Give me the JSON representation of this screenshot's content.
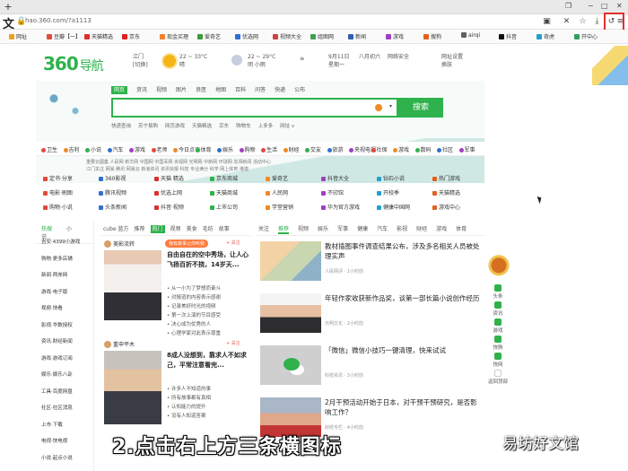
{
  "browser": {
    "url": "hao.360.com/?a1113",
    "window_buttons": [
      "−",
      "□",
      "✕"
    ],
    "addr_letter": "文"
  },
  "bookmarks": [
    {
      "label": "网址",
      "color": "#f0a020"
    },
    {
      "label": "豆瓣【一】",
      "color": "#e24a3b"
    },
    {
      "label": "天猫精选",
      "color": "#d83030"
    },
    {
      "label": "京东",
      "color": "#e02020"
    },
    {
      "label": "现金买理",
      "color": "#f08030"
    },
    {
      "label": "爱奇艺",
      "color": "#3a9a3a"
    },
    {
      "label": "优选网",
      "color": "#3070d0"
    },
    {
      "label": "视频大全",
      "color": "#d04040"
    },
    {
      "label": "组图网",
      "color": "#40a050"
    },
    {
      "label": "新闻",
      "color": "#3060b0"
    },
    {
      "label": "游戏",
      "color": "#a040c0"
    },
    {
      "label": "搜狗",
      "color": "#e06020"
    },
    {
      "label": "airqi",
      "color": "#606060"
    },
    {
      "label": "抖音",
      "color": "#111111"
    },
    {
      "label": "奇虎",
      "color": "#20a0d0"
    },
    {
      "label": "开中心",
      "color": "#30a060"
    }
  ],
  "header": {
    "logo_text": "360",
    "logo_sub": "导航",
    "city": "江门",
    "city_sub": "[切换]",
    "weather_today": "22 ~ 33°C",
    "weather_today_desc": "晴",
    "weather_tomorrow": "22 ~ 29°C",
    "weather_tomorrow_desc": "明 小雨",
    "date": "9月11日",
    "weekday": "星期一",
    "lunar": "八月初六",
    "notice": "网络安全",
    "settings": "网址设置",
    "skin": "换肤"
  },
  "search": {
    "tabs": [
      "网页",
      "资讯",
      "视频",
      "图片",
      "良医",
      "地图",
      "百科",
      "问答",
      "快递",
      "公布"
    ],
    "active_tab": "网页",
    "button": "搜索",
    "hints": [
      "快递查询",
      "苏宁易购",
      "网页游戏",
      "天猫精选",
      "京东",
      "购物车",
      "上多多",
      "网址 v"
    ]
  },
  "nav": [
    "卫生",
    "吉利",
    "小说",
    "汽车",
    "游戏",
    "老师",
    "今日点评",
    "体育",
    "娱乐",
    "购物",
    "生活",
    "财经",
    "交友",
    "旅游",
    "央视电视",
    "社保",
    "游戏",
    "数码",
    "社区",
    "军事"
  ],
  "subnav1": [
    "重要云图集",
    "人民网",
    "新华网",
    "中国网",
    "中国军网",
    "央视网",
    "光明网",
    "中新网",
    "环球网",
    "澎湃新闻",
    "活动中心"
  ],
  "subnav2": [
    "江门关注",
    "网易",
    "腾讯",
    "网易云",
    "新浪资讯",
    "资讯快报",
    "科技",
    "专业满分",
    "科学",
    "网上体育",
    "港澳"
  ],
  "sites": [
    [
      "定书·分享",
      "360影视",
      "天猫 精选",
      "京东商城",
      "爱奇艺",
      "抖音大全",
      "钻石小说",
      "热门游戏"
    ],
    [
      "电影·刷图",
      "腾讯视频",
      "优选上网",
      "天猫商城",
      "人民网",
      "不印馆",
      "开校季",
      "天猫精选"
    ],
    [
      "购物·小说",
      "头条新闻",
      "抖音·视频",
      "上市公司",
      "学堂营销",
      "华为官方游戏",
      "健康中国网",
      "游戏中心"
    ]
  ],
  "left_panel": {
    "tabs": [
      "热搜",
      "小说"
    ],
    "items": [
      "吉安·4399小游戏",
      "购物·更多店铺",
      "新闻·两岸网",
      "游戏·电子版",
      "视频·快看",
      "影视·华数授权",
      "资讯·财经新闻",
      "游戏·游戏订阅",
      "娱乐·娱乐八卦",
      "工具·百度网盘",
      "社区·社区消息",
      "上市·下载",
      "电视·快电视",
      "小说·起点小说"
    ]
  },
  "mid_panel": {
    "tabs": [
      "cube 蓝方",
      "推荐",
      "热门",
      "视频",
      "美食",
      "毛纺",
      "故事"
    ],
    "active_tab": "热门",
    "cards": [
      {
        "user": "美影流转",
        "pill": "我有故事让你听我",
        "title": "自由自在的空中秀场，让人心飞扬百折不挠，14岁天...",
        "lines": [
          "• 从一小为了梦想而奋斗",
          "• 对报道的内容表示感谢",
          "• 记录美好时光的视频",
          "• 第一次上演的节目感受",
          "• 决心成为优秀的人",
          "• 心理学家对此表示尊重"
        ]
      },
      {
        "user": "重申平木",
        "pill": "",
        "title": "8成人没想到，靠求人不如求己，平常注意看完...",
        "lines": [
          "• 许多人不知道的事",
          "• 所有故事都有真相",
          "• 认知能力的提升",
          "• 没有人知道答案"
        ]
      }
    ]
  },
  "right_panel": {
    "tabs": [
      "关注",
      "推荐",
      "视频",
      "娱乐",
      "军事",
      "健康",
      "汽车",
      "影视",
      "财经",
      "游戏",
      "体育"
    ],
    "active_tab": "推荐",
    "items": [
      {
        "title": "教材插图事件调查结果公布，涉及多名相关人员被处理实声",
        "meta": "人民网评 · 1小时前"
      },
      {
        "title": "年轻作家收获新作品奖，谈第一部长篇小说创作经历",
        "meta": "光明文化 · 2小时前"
      },
      {
        "title": "「微信」微信小技巧一键清理，快来试试",
        "meta": "科技资讯 · 3小时前"
      },
      {
        "title": "2月干预活动开始于日本，对干预干预研究，是否影响工作？",
        "meta": "财经专栏 · 4小时前"
      }
    ]
  },
  "float_bar": [
    "头条",
    "资讯",
    "游戏",
    "快购",
    "快网",
    "返回顶部"
  ],
  "overlay": {
    "caption": "2.点击右上方三条横图标",
    "watermark": "易坊好文馆"
  },
  "colors": {
    "brand_green": "#2fb24c",
    "highlight_red": "#e0302e"
  }
}
